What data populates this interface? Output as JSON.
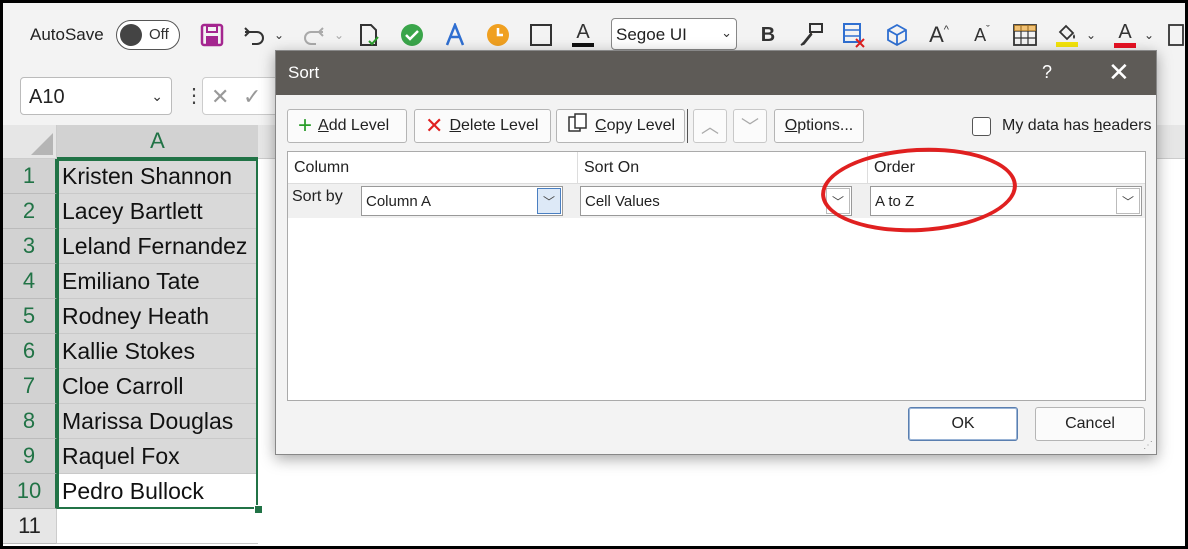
{
  "ribbon": {
    "autosave_label": "AutoSave",
    "autosave_state": "Off",
    "font_name": "Segoe UI",
    "bold_label": "B",
    "font_color_label": "A",
    "grow_font_label": "A",
    "shrink_font_label": "A",
    "highlight_color": "#f5e50b",
    "font_color": "#e81123"
  },
  "formula_bar": {
    "name_box_value": "A10"
  },
  "sheet": {
    "column_header": "A",
    "rows": [
      {
        "num": "1",
        "value": "Kristen Shannon"
      },
      {
        "num": "2",
        "value": "Lacey Bartlett"
      },
      {
        "num": "3",
        "value": "Leland Fernandez"
      },
      {
        "num": "4",
        "value": "Emiliano Tate"
      },
      {
        "num": "5",
        "value": "Rodney Heath"
      },
      {
        "num": "6",
        "value": "Kallie Stokes"
      },
      {
        "num": "7",
        "value": "Cloe Carroll"
      },
      {
        "num": "8",
        "value": "Marissa Douglas"
      },
      {
        "num": "9",
        "value": "Raquel Fox"
      },
      {
        "num": "10",
        "value": "Pedro Bullock"
      },
      {
        "num": "11",
        "value": ""
      }
    ]
  },
  "dialog": {
    "title": "Sort",
    "help": "?",
    "close": "✕",
    "add_level": {
      "underline": "A",
      "rest": "dd Level"
    },
    "delete_level": {
      "underline": "D",
      "rest": "elete Level"
    },
    "copy_level": {
      "underline": "C",
      "rest": "opy Level"
    },
    "options": {
      "underline": "O",
      "rest": "ptions..."
    },
    "headers_checkbox": {
      "prefix": "My data has ",
      "underline": "h",
      "rest": "eaders",
      "checked": false
    },
    "columns": {
      "column": "Column",
      "sort_on": "Sort On",
      "order": "Order"
    },
    "level": {
      "label": "Sort by",
      "column": "Column A",
      "sort_on": "Cell Values",
      "order": "A to Z"
    },
    "ok": "OK",
    "cancel": "Cancel"
  },
  "colors": {
    "excel_green": "#217346",
    "title_bar": "#5e5b57",
    "annotation_red": "#e02020"
  }
}
